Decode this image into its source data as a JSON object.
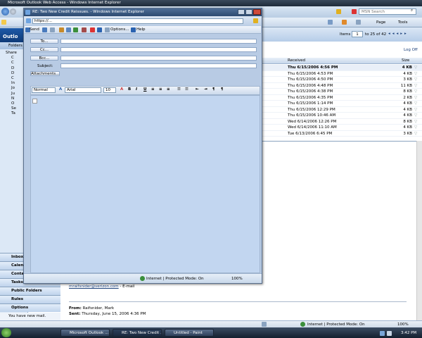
{
  "outer_window": {
    "title": "Microsoft Outlook Web Access - Windows Internet Explorer"
  },
  "outer_search": {
    "placeholder": "MSN Search"
  },
  "outer_commandbar": {
    "page": "Page",
    "tools": "Tools"
  },
  "owa": {
    "logo": "Outlo",
    "folders_label": "Folders",
    "tree": [
      "Share",
      "C",
      "C",
      "D",
      "D",
      "C",
      "In",
      "Jo",
      "Ju",
      "N",
      "O",
      "Se",
      "Ta"
    ],
    "pager": {
      "items_label": "Items",
      "current": "1",
      "range_text": "to 25 of 42"
    },
    "logoff": "Log Off",
    "list_header": {
      "received": "Received",
      "size": "Size"
    },
    "messages": [
      {
        "received": "Thu 6/15/2006 4:56 PM",
        "size": "4 KB",
        "bold": true
      },
      {
        "received": "Thu 6/15/2006 4:53 PM",
        "size": "4 KB"
      },
      {
        "received": "Thu 6/15/2006 4:50 PM",
        "size": "3 KB"
      },
      {
        "received": "Thu 6/15/2006 4:48 PM",
        "size": "11 KB"
      },
      {
        "received": "Thu 6/15/2006 4:38 PM",
        "size": "8 KB"
      },
      {
        "received": "Thu 6/15/2006 4:35 PM",
        "size": "2 KB"
      },
      {
        "received": "Thu 6/15/2006 1:14 PM",
        "size": "4 KB"
      },
      {
        "received": "Thu 6/15/2006 12:29 PM",
        "size": "4 KB"
      },
      {
        "received": "Thu 6/15/2006 10:46 AM",
        "size": "4 KB"
      },
      {
        "received": "Wed 6/14/2006 12:26 PM",
        "size": "8 KB"
      },
      {
        "received": "Wed 6/14/2006 11:10 AM",
        "size": "4 KB"
      },
      {
        "received": "Tue 6/13/2006 6:45 PM",
        "size": "3 KB"
      }
    ],
    "nav_buttons": [
      "Inbox",
      "Calend",
      "Conta",
      "Tasks",
      "Public Folders",
      "Rules",
      "Options"
    ],
    "new_mail_status": "You have new mail.",
    "reading": {
      "email_link": "mraifsnider@verizon.com",
      "email_suffix": " - E-mail",
      "from_label": "From:",
      "from_value": "Raifsnider, Mark",
      "sent_label": "Sent:",
      "sent_value": "Thursday, June 15, 2006 4:36 PM"
    }
  },
  "compose": {
    "title": "RE: Two New Credit Reissues. - Windows Internet Explorer",
    "url": "https://...",
    "toolbar": {
      "send": "Send",
      "options": "Options...",
      "help": "Help"
    },
    "to_label": "To...",
    "cc_label": "Cc...",
    "bcc_label": "Bcc...",
    "subject_label": "Subject:",
    "attachments_label": "Attachments...",
    "format": {
      "style": "Normal",
      "font": "Arial",
      "size": "10"
    },
    "status": {
      "zone": "Internet | Protected Mode: On",
      "zoom": "100%"
    }
  },
  "outer_status": {
    "zone": "Internet | Protected Mode: On",
    "zoom": "100%"
  },
  "taskbar": {
    "items": [
      "Microsoft Outlook ...",
      "RE: Two New Credit ...",
      "Untitled - Paint"
    ],
    "clock": "3:42 PM"
  },
  "colors": {
    "accent": "#1e5aa8",
    "title_bar": "#2c4a70",
    "compose_body": "#c2d6f0"
  }
}
